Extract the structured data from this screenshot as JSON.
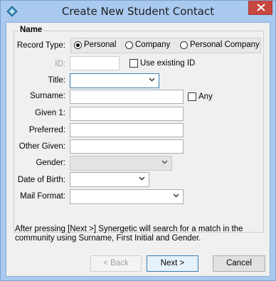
{
  "window": {
    "title": "Create New Student Contact"
  },
  "group": {
    "title": "Name"
  },
  "record_type": {
    "label": "Record Type:",
    "options": [
      {
        "label": "Personal",
        "selected": true
      },
      {
        "label": "Company",
        "selected": false
      },
      {
        "label": "Personal Company",
        "selected": false
      }
    ]
  },
  "fields": {
    "id_label": "ID:",
    "id_value": "",
    "use_existing_id_label": "Use existing ID",
    "title_label": "Title:",
    "title_value": "",
    "surname_label": "Surname:",
    "surname_value": "",
    "any_label": "Any",
    "given1_label": "Given 1:",
    "given1_value": "",
    "preferred_label": "Preferred:",
    "preferred_value": "",
    "other_given_label": "Other Given:",
    "other_given_value": "",
    "gender_label": "Gender:",
    "gender_value": "",
    "dob_label": "Date of Birth:",
    "dob_value": "",
    "mail_format_label": "Mail Format:",
    "mail_format_value": ""
  },
  "info_text": "After pressing [Next >] Synergetic will search for a match in the community using Surname, First Initial and Gender.",
  "buttons": {
    "back": "< Back",
    "next": "Next >",
    "cancel": "Cancel"
  },
  "colors": {
    "titlebar": "#a9c9ee",
    "close": "#c7463f",
    "client": "#f0f0f0"
  }
}
